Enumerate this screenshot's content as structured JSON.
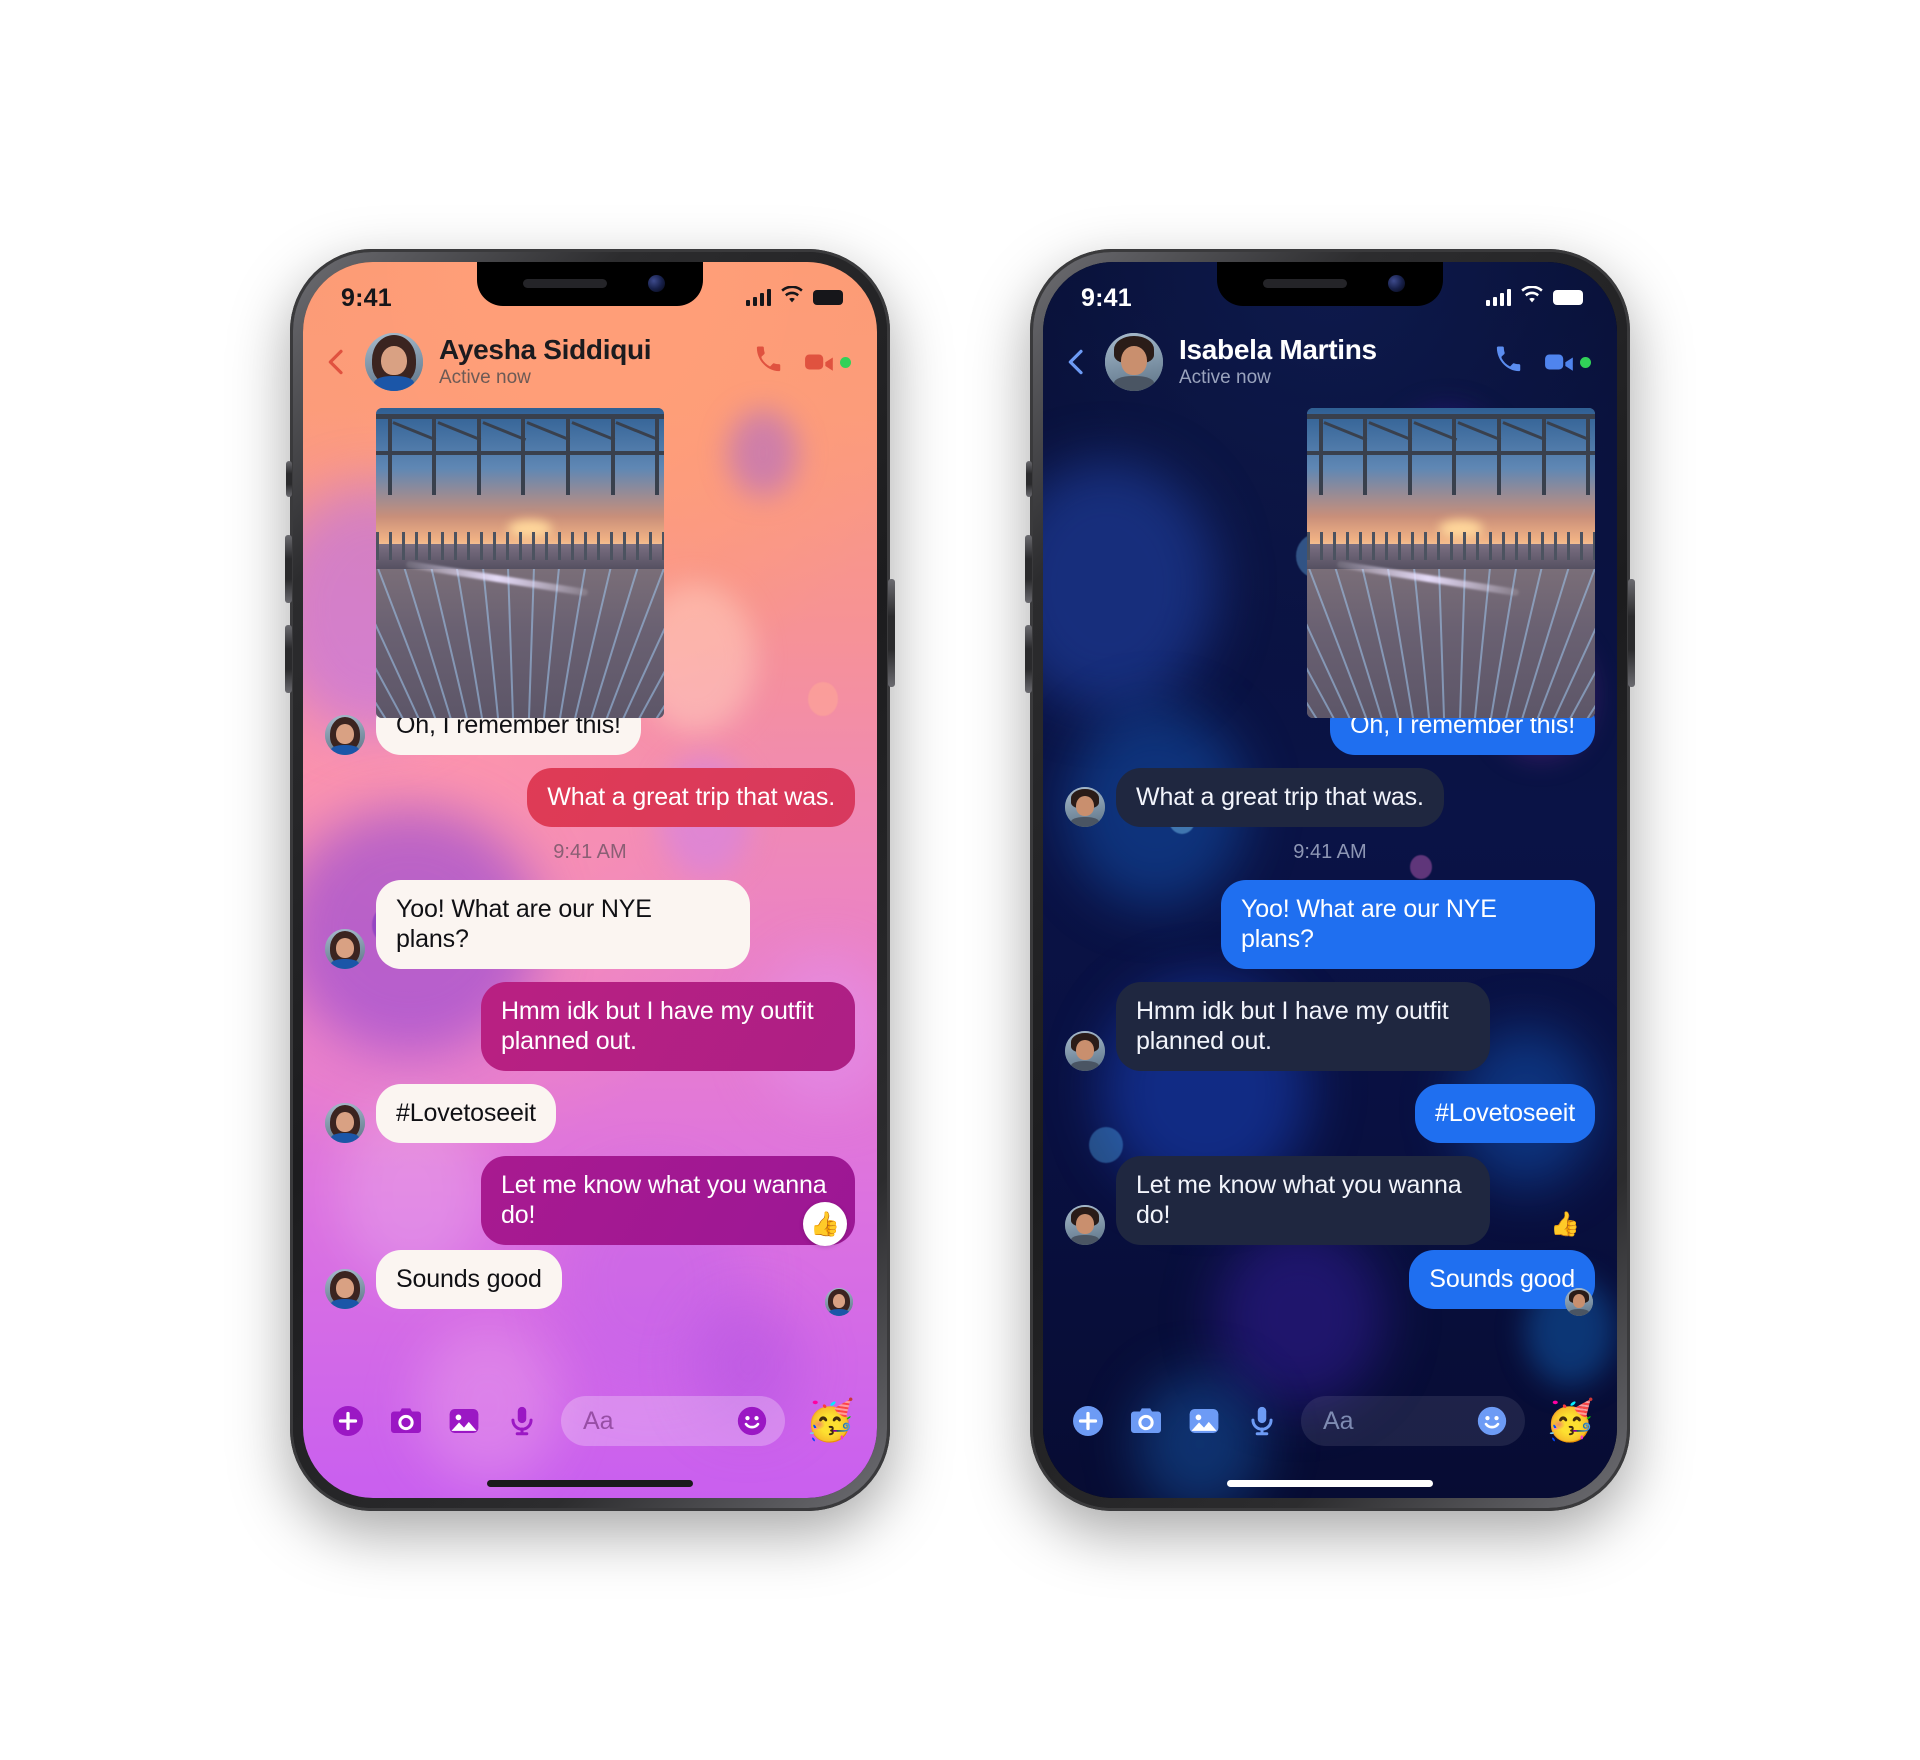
{
  "phones": [
    {
      "id": "light",
      "theme": "light",
      "status_bar": {
        "time": "9:41",
        "signal_icon": "cellular-bars-icon",
        "wifi_icon": "wifi-icon",
        "battery_icon": "battery-full-icon"
      },
      "header": {
        "back_icon": "back-chevron-icon",
        "avatar": "contact-avatar",
        "name": "Ayesha Siddiqui",
        "status": "Active now",
        "call_icon": "phone-call-icon",
        "video_icon": "video-camera-icon",
        "online_dot": "online-status-dot"
      },
      "messages": [
        {
          "kind": "photo",
          "side": "in",
          "alt": "pier-at-sunset-photo"
        },
        {
          "kind": "text",
          "side": "in",
          "text": "Oh, I remember this!",
          "avatar": true
        },
        {
          "kind": "text",
          "side": "out",
          "text": "What a great trip that was.",
          "tone": "o1"
        },
        {
          "kind": "stamp",
          "text": "9:41 AM"
        },
        {
          "kind": "text",
          "side": "in",
          "text": "Yoo! What are our NYE plans?",
          "avatar": true
        },
        {
          "kind": "text",
          "side": "out",
          "text": "Hmm idk but I have my outfit planned out.",
          "tone": "o2"
        },
        {
          "kind": "text",
          "side": "in",
          "text": "#Lovetoseeit",
          "avatar": true
        },
        {
          "kind": "text",
          "side": "out",
          "text": "Let me know what you wanna do!",
          "tone": "o3",
          "reaction": "👍"
        },
        {
          "kind": "text",
          "side": "in",
          "text": "Sounds good",
          "avatar": true,
          "seen": true
        }
      ],
      "composer": {
        "plus_icon": "add-plus-icon",
        "camera_icon": "camera-icon",
        "gallery_icon": "photo-gallery-icon",
        "mic_icon": "microphone-icon",
        "placeholder": "Aa",
        "emoji_icon": "emoji-smiley-icon",
        "sticker": "🥳"
      },
      "colors": {
        "wallpaper_top": "#fb9a74",
        "wallpaper_bottom": "#c95fef",
        "bubble_in": "#fbf5f1",
        "bubble_out_top": "#df3b55",
        "bubble_out_bottom": "#9c1795",
        "accent_icon": "#9b17c4",
        "back_chevron": "#e0523f"
      }
    },
    {
      "id": "dark",
      "theme": "dark",
      "status_bar": {
        "time": "9:41",
        "signal_icon": "cellular-bars-icon",
        "wifi_icon": "wifi-icon",
        "battery_icon": "battery-full-icon"
      },
      "header": {
        "back_icon": "back-chevron-icon",
        "avatar": "contact-avatar",
        "name": "Isabela Martins",
        "status": "Active now",
        "call_icon": "phone-call-icon",
        "video_icon": "video-camera-icon",
        "online_dot": "online-status-dot"
      },
      "messages": [
        {
          "kind": "photo",
          "side": "out",
          "alt": "pier-at-sunset-photo"
        },
        {
          "kind": "text",
          "side": "out",
          "text": "Oh, I remember this!",
          "tone": "o1"
        },
        {
          "kind": "text",
          "side": "in",
          "text": "What a great trip that was.",
          "avatar": true
        },
        {
          "kind": "stamp",
          "text": "9:41 AM"
        },
        {
          "kind": "text",
          "side": "out",
          "text": "Yoo! What are our NYE plans?",
          "tone": "o1"
        },
        {
          "kind": "text",
          "side": "in",
          "text": "Hmm idk but I have my outfit planned out.",
          "avatar": true
        },
        {
          "kind": "text",
          "side": "out",
          "text": "#Lovetoseeit",
          "tone": "o1"
        },
        {
          "kind": "text",
          "side": "in",
          "text": "Let me know what you wanna do!",
          "avatar": true,
          "reaction": "👍"
        },
        {
          "kind": "text",
          "side": "out",
          "text": "Sounds good",
          "tone": "o1",
          "seen": true
        }
      ],
      "composer": {
        "plus_icon": "add-plus-icon",
        "camera_icon": "camera-icon",
        "gallery_icon": "photo-gallery-icon",
        "mic_icon": "microphone-icon",
        "placeholder": "Aa",
        "emoji_icon": "emoji-smiley-icon",
        "sticker": "🥳"
      },
      "colors": {
        "wallpaper_top": "#080f33",
        "wallpaper_bottom": "#070c33",
        "bubble_in": "#1f2740",
        "bubble_out_top": "#1f6ff0",
        "bubble_out_bottom": "#1f6ff0",
        "accent_icon": "#6d9bf5",
        "back_chevron": "#6d9bf5"
      }
    }
  ]
}
